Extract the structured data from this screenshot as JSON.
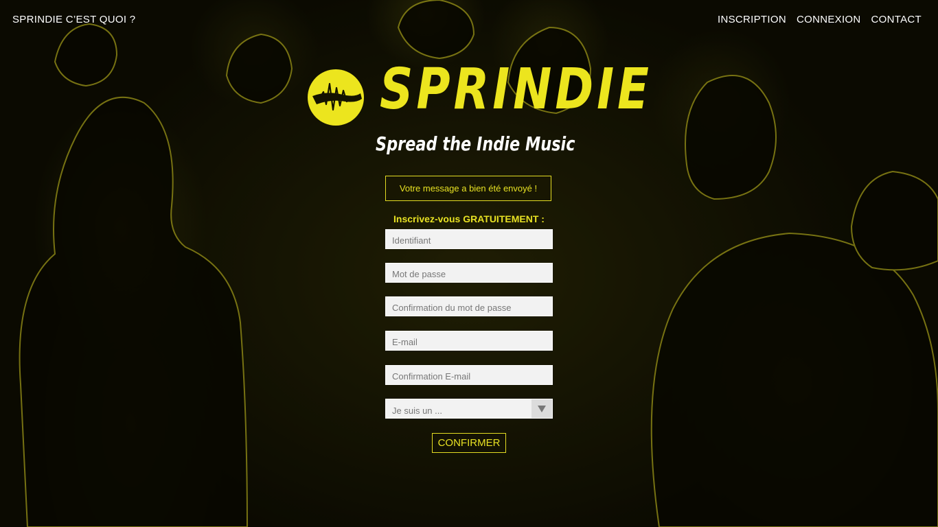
{
  "nav": {
    "about_label": "SPRINDIE C’EST QUOI ?",
    "items": [
      {
        "label": "INSCRIPTION"
      },
      {
        "label": "CONNEXION"
      },
      {
        "label": "CONTACT"
      }
    ]
  },
  "brand": {
    "name": "SPRINDIE",
    "tagline": "Spread the Indie Music",
    "accent_color": "#ece51e"
  },
  "flash": {
    "message": "Votre message a bien été envoyé !"
  },
  "signup": {
    "title": "Inscrivez-vous GRATUITEMENT :",
    "fields": {
      "username": {
        "placeholder": "Identifiant"
      },
      "password": {
        "placeholder": "Mot de passe"
      },
      "password_confirm": {
        "placeholder": "Confirmation du mot de passe"
      },
      "email": {
        "placeholder": "E-mail"
      },
      "email_confirm": {
        "placeholder": "Confirmation E-mail"
      }
    },
    "role_select": {
      "selected": "Je suis un ..."
    },
    "submit_label": "CONFIRMER"
  },
  "icons": {
    "logo": "sprindie-waveform-logo-icon",
    "dropdown": "triangle-down-icon"
  }
}
